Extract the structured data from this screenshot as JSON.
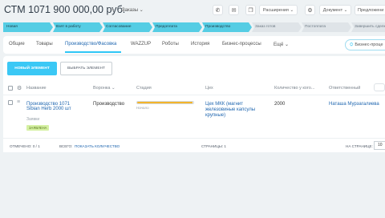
{
  "header": {
    "title": "СТМ 1071 900 000,00 руб.",
    "funnel": "Заказы",
    "buttons": {
      "phone": "✆",
      "mail": "✉",
      "copy": "❐",
      "extensions": "Расширения",
      "settings": "⚙",
      "document": "Документ",
      "more": "Предложени"
    }
  },
  "stages": [
    {
      "label": "Новая",
      "state": "active"
    },
    {
      "label": "Взят в работу",
      "state": "active"
    },
    {
      "label": "Согласование",
      "state": "active"
    },
    {
      "label": "Предоплата",
      "state": "active"
    },
    {
      "label": "Производство",
      "state": "active"
    },
    {
      "label": "Заказ готов",
      "state": "inactive"
    },
    {
      "label": "Постоплата",
      "state": "inactive"
    },
    {
      "label": "Завершить сделку",
      "state": "inactive"
    }
  ],
  "tabs": [
    {
      "label": "Общие"
    },
    {
      "label": "Товары"
    },
    {
      "label": "Производство/Фасовка",
      "active": true
    },
    {
      "label": "WAZZUP"
    },
    {
      "label": "Роботы"
    },
    {
      "label": "История"
    },
    {
      "label": "Бизнес-процессы"
    },
    {
      "label": "Ещё ⌄"
    }
  ],
  "bp_button": "Бизнес-проце",
  "toolbar": {
    "new_element": "НОВЫЙ ЭЛЕМЕНТ",
    "select_element": "ВЫБРАТЬ ЭЛЕМЕНТ"
  },
  "table": {
    "columns": {
      "gear": "⚙",
      "name": "Название",
      "funnel": "Воронка ⌄",
      "stage": "Стадия",
      "price": "Цех",
      "qty": "Количество у кого...",
      "responsible": "Ответственный"
    },
    "row": {
      "name_line1": "Производство 1071",
      "name_line2": "Sibian Herb 2000 шт",
      "subtitle": "Заявки",
      "badge": "ЗАЯВЛЕНА",
      "funnel": "Производство",
      "stage_progress": 0.98,
      "stage_label": "Начало",
      "price_line1": "Цех МКК (магнит",
      "price_line2": "железовиные капсулы",
      "price_line3": "крупные)",
      "qty": "2000",
      "responsible": "Наташа Мурзагалиева"
    }
  },
  "footer": {
    "selected": "ОТМЕЧЕНО: 0 / 1",
    "total_prefix": "ВСЕГО:",
    "total_link": "ПОКАЗАТЬ КОЛИЧЕСТВО",
    "pages": "СТРАНИЦЫ: 1",
    "page_size_label": "НА СТРАНИЦЕ:",
    "page_size": "10"
  },
  "colors": {
    "accent": "#3bc8f5",
    "stage_active": "#55cde4",
    "link": "#2067b0",
    "progress": "#f3b52b"
  }
}
